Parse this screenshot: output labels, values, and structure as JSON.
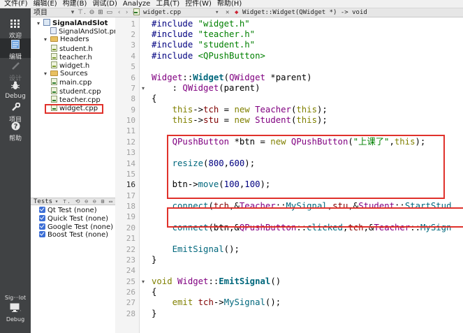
{
  "menu": [
    "文件(F)",
    "编辑(E)",
    "构建(B)",
    "调试(D)",
    "Analyze",
    "工具(T)",
    "控件(W)",
    "帮助(H)"
  ],
  "modes": [
    {
      "label": "欢迎",
      "icon": "grid-icon"
    },
    {
      "label": "编辑",
      "icon": "edit-doc-icon"
    },
    {
      "label": "设计",
      "icon": "pencil-icon"
    },
    {
      "label": "Debug",
      "icon": "bug-icon"
    },
    {
      "label": "项目",
      "icon": "wrench-icon"
    },
    {
      "label": "帮助",
      "icon": "help-icon"
    }
  ],
  "bottom_mode": {
    "label": "Sig···lot",
    "sub": "Debug"
  },
  "project_panel": {
    "title": "项目",
    "tree": [
      {
        "label": "SignalAndSlot",
        "level": 0,
        "type": "project",
        "expanded": true
      },
      {
        "label": "SignalAndSlot.pro",
        "level": 1,
        "type": "pro"
      },
      {
        "label": "Headers",
        "level": 1,
        "type": "folder",
        "expanded": true
      },
      {
        "label": "student.h",
        "level": 2,
        "type": "h"
      },
      {
        "label": "teacher.h",
        "level": 2,
        "type": "h"
      },
      {
        "label": "widget.h",
        "level": 2,
        "type": "h"
      },
      {
        "label": "Sources",
        "level": 1,
        "type": "folder",
        "expanded": true
      },
      {
        "label": "main.cpp",
        "level": 2,
        "type": "cpp"
      },
      {
        "label": "student.cpp",
        "level": 2,
        "type": "cpp"
      },
      {
        "label": "teacher.cpp",
        "level": 2,
        "type": "cpp"
      },
      {
        "label": "widget.cpp",
        "level": 2,
        "type": "cpp",
        "highlighted": true
      }
    ]
  },
  "tests_panel": {
    "title": "Tests",
    "items": [
      "Qt Test (none)",
      "Quick Test (none)",
      "Google Test (none)",
      "Boost Test (none)"
    ]
  },
  "editor": {
    "file_name": "widget.cpp",
    "symbol": "Widget::Widget(QWidget *) -> void",
    "current_line": 16,
    "lines": [
      {
        "n": 1,
        "tokens": [
          [
            "pp",
            "#include "
          ],
          [
            "str",
            "\"widget.h\""
          ]
        ]
      },
      {
        "n": 2,
        "tokens": [
          [
            "pp",
            "#include "
          ],
          [
            "str",
            "\"teacher.h\""
          ]
        ]
      },
      {
        "n": 3,
        "tokens": [
          [
            "pp",
            "#include "
          ],
          [
            "str",
            "\"student.h\""
          ]
        ]
      },
      {
        "n": 4,
        "tokens": [
          [
            "pp",
            "#include "
          ],
          [
            "str",
            "<QPushButton>"
          ]
        ]
      },
      {
        "n": 5,
        "tokens": []
      },
      {
        "n": 6,
        "tokens": [
          [
            "type",
            "Widget"
          ],
          [
            "",
            "::"
          ],
          [
            "bold",
            "Widget"
          ],
          [
            "",
            "("
          ],
          [
            "type",
            "QWidget"
          ],
          [
            "",
            " *"
          ],
          [
            "",
            "parent"
          ],
          [
            "",
            ")"
          ]
        ]
      },
      {
        "n": 7,
        "fold": true,
        "tokens": [
          [
            "",
            "    : "
          ],
          [
            "type",
            "QWidget"
          ],
          [
            "",
            "(parent)"
          ]
        ]
      },
      {
        "n": 8,
        "tokens": [
          [
            "",
            "{"
          ]
        ]
      },
      {
        "n": 9,
        "tokens": [
          [
            "",
            "    "
          ],
          [
            "kw",
            "this"
          ],
          [
            "",
            "->"
          ],
          [
            "var",
            "tch"
          ],
          [
            "",
            " = "
          ],
          [
            "kw",
            "new"
          ],
          [
            "",
            " "
          ],
          [
            "type",
            "Teacher"
          ],
          [
            "",
            "("
          ],
          [
            "kw",
            "this"
          ],
          [
            "",
            ");"
          ]
        ]
      },
      {
        "n": 10,
        "tokens": [
          [
            "",
            "    "
          ],
          [
            "kw",
            "this"
          ],
          [
            "",
            "->"
          ],
          [
            "var",
            "stu"
          ],
          [
            "",
            " = "
          ],
          [
            "kw",
            "new"
          ],
          [
            "",
            " "
          ],
          [
            "type",
            "Student"
          ],
          [
            "",
            "("
          ],
          [
            "kw",
            "this"
          ],
          [
            "",
            ");"
          ]
        ]
      },
      {
        "n": 11,
        "tokens": []
      },
      {
        "n": 12,
        "tokens": [
          [
            "",
            "    "
          ],
          [
            "type",
            "QPushButton"
          ],
          [
            "",
            " *btn = "
          ],
          [
            "kw",
            "new"
          ],
          [
            "",
            " "
          ],
          [
            "type",
            "QPushButton"
          ],
          [
            "",
            "("
          ],
          [
            "str",
            "\"上课了\""
          ],
          [
            "",
            ","
          ],
          [
            "kw",
            "this"
          ],
          [
            "",
            ");"
          ]
        ]
      },
      {
        "n": 13,
        "tokens": []
      },
      {
        "n": 14,
        "tokens": [
          [
            "",
            "    "
          ],
          [
            "fn",
            "resize"
          ],
          [
            "",
            "("
          ],
          [
            "num",
            "800"
          ],
          [
            "",
            ","
          ],
          [
            "num",
            "600"
          ],
          [
            "",
            ");"
          ]
        ]
      },
      {
        "n": 15,
        "tokens": []
      },
      {
        "n": 16,
        "tokens": [
          [
            "",
            "    btn->"
          ],
          [
            "fn",
            "move"
          ],
          [
            "",
            "("
          ],
          [
            "num",
            "100"
          ],
          [
            "",
            ","
          ],
          [
            "num",
            "100"
          ],
          [
            "",
            ");"
          ]
        ]
      },
      {
        "n": 17,
        "tokens": []
      },
      {
        "n": 18,
        "tokens": [
          [
            "",
            "    "
          ],
          [
            "fn",
            "connect"
          ],
          [
            "",
            "("
          ],
          [
            "var",
            "tch"
          ],
          [
            "",
            ",&"
          ],
          [
            "type",
            "Teacher"
          ],
          [
            "",
            "::"
          ],
          [
            "fn",
            "MySignal"
          ],
          [
            "",
            ","
          ],
          [
            "var",
            "stu"
          ],
          [
            "",
            ",&"
          ],
          [
            "type",
            "Student"
          ],
          [
            "",
            "::"
          ],
          [
            "fn",
            "StartStud"
          ]
        ]
      },
      {
        "n": 19,
        "tokens": []
      },
      {
        "n": 20,
        "tokens": [
          [
            "",
            "    "
          ],
          [
            "fn",
            "connect"
          ],
          [
            "",
            "(btn,&"
          ],
          [
            "type",
            "QPushButton"
          ],
          [
            "",
            "::"
          ],
          [
            "fn",
            "clicked"
          ],
          [
            "",
            ","
          ],
          [
            "var",
            "tch"
          ],
          [
            "",
            ",&"
          ],
          [
            "type",
            "Teacher"
          ],
          [
            "",
            "::"
          ],
          [
            "fn",
            "MySign"
          ]
        ]
      },
      {
        "n": 21,
        "tokens": []
      },
      {
        "n": 22,
        "tokens": [
          [
            "",
            "    "
          ],
          [
            "fn",
            "EmitSignal"
          ],
          [
            "",
            "();"
          ]
        ]
      },
      {
        "n": 23,
        "tokens": [
          [
            "",
            "}"
          ]
        ]
      },
      {
        "n": 24,
        "tokens": []
      },
      {
        "n": 25,
        "fold": true,
        "tokens": [
          [
            "kw",
            "void"
          ],
          [
            "",
            " "
          ],
          [
            "type",
            "Widget"
          ],
          [
            "",
            "::"
          ],
          [
            "bold",
            "EmitSignal"
          ],
          [
            "",
            "()"
          ]
        ]
      },
      {
        "n": 26,
        "tokens": [
          [
            "",
            "{"
          ]
        ]
      },
      {
        "n": 27,
        "tokens": [
          [
            "",
            "    "
          ],
          [
            "kw",
            "emit"
          ],
          [
            "",
            " "
          ],
          [
            "var",
            "tch"
          ],
          [
            "",
            "->"
          ],
          [
            "fn",
            "MySignal"
          ],
          [
            "",
            "();"
          ]
        ]
      },
      {
        "n": 28,
        "tokens": [
          [
            "",
            "}"
          ]
        ]
      }
    ]
  },
  "colors": {
    "highlight_border": "#e0312b",
    "modebar": "#404244"
  }
}
